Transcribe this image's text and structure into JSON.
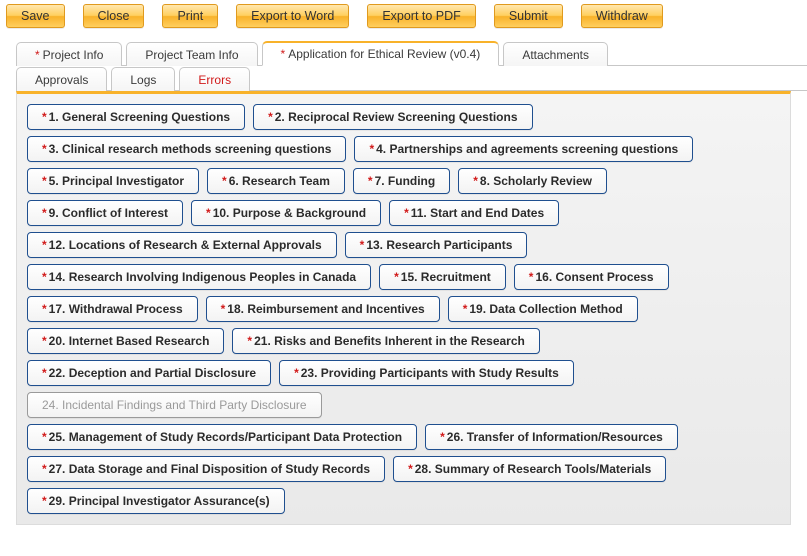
{
  "toolbar": {
    "save": "Save",
    "close": "Close",
    "print": "Print",
    "word": "Export to Word",
    "pdf": "Export to PDF",
    "submit": "Submit",
    "withdraw": "Withdraw"
  },
  "tabs1": {
    "project_info_req": "*",
    "project_info": "Project Info",
    "team_info": "Project Team Info",
    "app_req": "*",
    "app": "Application for Ethical Review (v0.4)",
    "attachments": "Attachments"
  },
  "tabs2": {
    "approvals": "Approvals",
    "logs": "Logs",
    "errors": "Errors"
  },
  "steps": {
    "s1": "1. General Screening Questions",
    "s2": "2. Reciprocal Review Screening Questions",
    "s3": "3. Clinical research methods screening questions",
    "s4": "4. Partnerships and agreements screening questions",
    "s5": "5. Principal Investigator",
    "s6": "6. Research Team",
    "s7": "7. Funding",
    "s8": "8. Scholarly Review",
    "s9": "9. Conflict of Interest",
    "s10": "10. Purpose & Background",
    "s11": "11. Start and End Dates",
    "s12": "12. Locations of Research & External Approvals",
    "s13": "13. Research Participants",
    "s14": "14. Research Involving Indigenous Peoples in Canada",
    "s15": "15. Recruitment",
    "s16": "16. Consent Process",
    "s17": "17. Withdrawal Process",
    "s18": "18. Reimbursement and Incentives",
    "s19": "19. Data Collection Method",
    "s20": "20. Internet Based Research",
    "s21": "21. Risks and Benefits Inherent in the Research",
    "s22": "22. Deception and Partial Disclosure",
    "s23": "23. Providing Participants with Study Results",
    "s24": "24. Incidental Findings and Third Party Disclosure",
    "s25": "25. Management of Study Records/Participant Data Protection",
    "s26": "26. Transfer of Information/Resources",
    "s27": "27. Data Storage and Final Disposition of Study Records",
    "s28": "28. Summary of Research Tools/Materials",
    "s29": "29. Principal Investigator Assurance(s)"
  }
}
